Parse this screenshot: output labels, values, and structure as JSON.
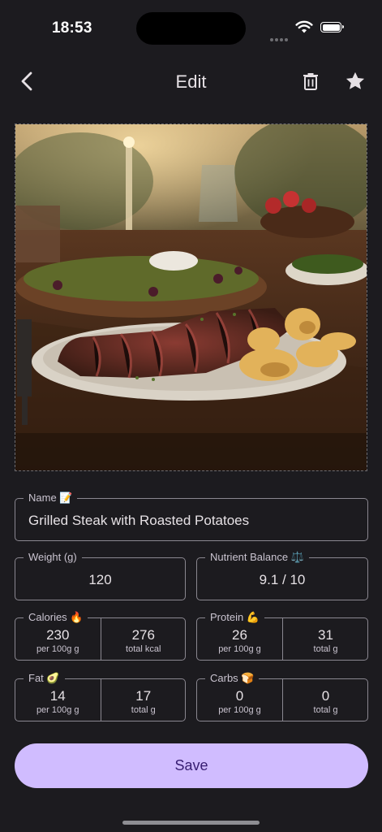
{
  "status_bar": {
    "time": "18:53"
  },
  "app_bar": {
    "title": "Edit"
  },
  "photo": {
    "description_icon": "food-photo"
  },
  "form": {
    "name": {
      "label": "Name 📝",
      "value": "Grilled Steak with Roasted Potatoes"
    },
    "weight": {
      "label": "Weight (g)",
      "value": "120"
    },
    "balance": {
      "label": "Nutrient Balance ⚖️",
      "value": "9.1 / 10"
    },
    "calories": {
      "label": "Calories 🔥",
      "per100": "230",
      "per100_unit": "per 100g g",
      "total": "276",
      "total_unit": "total kcal"
    },
    "protein": {
      "label": "Protein 💪",
      "per100": "26",
      "per100_unit": "per 100g g",
      "total": "31",
      "total_unit": "total g"
    },
    "fat": {
      "label": "Fat 🥑",
      "per100": "14",
      "per100_unit": "per 100g g",
      "total": "17",
      "total_unit": "total g"
    },
    "carbs": {
      "label": "Carbs 🍞",
      "per100": "0",
      "per100_unit": "per 100g g",
      "total": "0",
      "total_unit": "total g"
    }
  },
  "actions": {
    "save_label": "Save"
  },
  "colors": {
    "background": "#1c1b1f",
    "accent": "#d0bcff",
    "on_accent": "#381e72",
    "outline": "#8a8790"
  }
}
